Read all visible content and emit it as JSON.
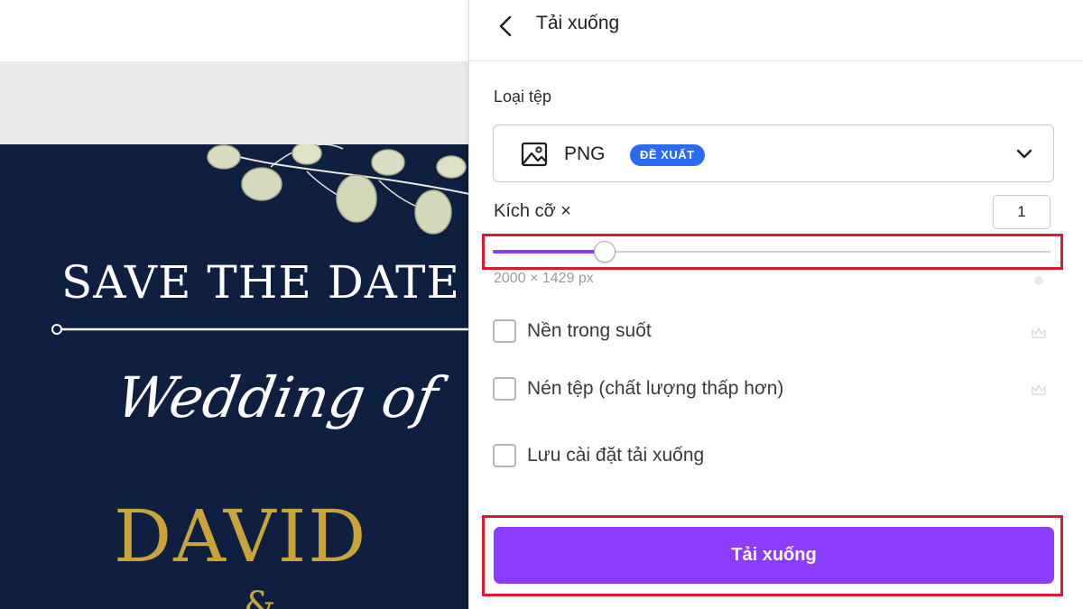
{
  "design": {
    "save_the_date": "SAVE THE DATE",
    "wedding_of": "Wedding of",
    "name": "DAVID",
    "ampersand": "&",
    "colors": {
      "background": "#0f1f3f",
      "gold": "#c9a43a"
    }
  },
  "panel": {
    "title": "Tải xuống",
    "back_icon": "chevron-left-icon",
    "file_type": {
      "label": "Loại tệp",
      "value": "PNG",
      "badge": "ĐỀ XUẤT",
      "icon": "image-icon",
      "dropdown_icon": "chevron-down-icon"
    },
    "size": {
      "label": "Kích cỡ ×",
      "value": "1",
      "slider_fraction": 0.2,
      "dimensions": "2000 × 1429 px"
    },
    "options": [
      {
        "label": "Nền trong suốt",
        "checked": false,
        "premium_icon": "crown-icon"
      },
      {
        "label": "Nén tệp (chất lượng thấp hơn)",
        "checked": false,
        "premium_icon": "crown-icon"
      },
      {
        "label": "Lưu cài đặt tải xuống",
        "checked": false
      }
    ],
    "download_button": "Tải xuống",
    "accent_color": "#8b3dff",
    "badge_color": "#2b6bf2",
    "highlight_color": "#e3162b"
  }
}
